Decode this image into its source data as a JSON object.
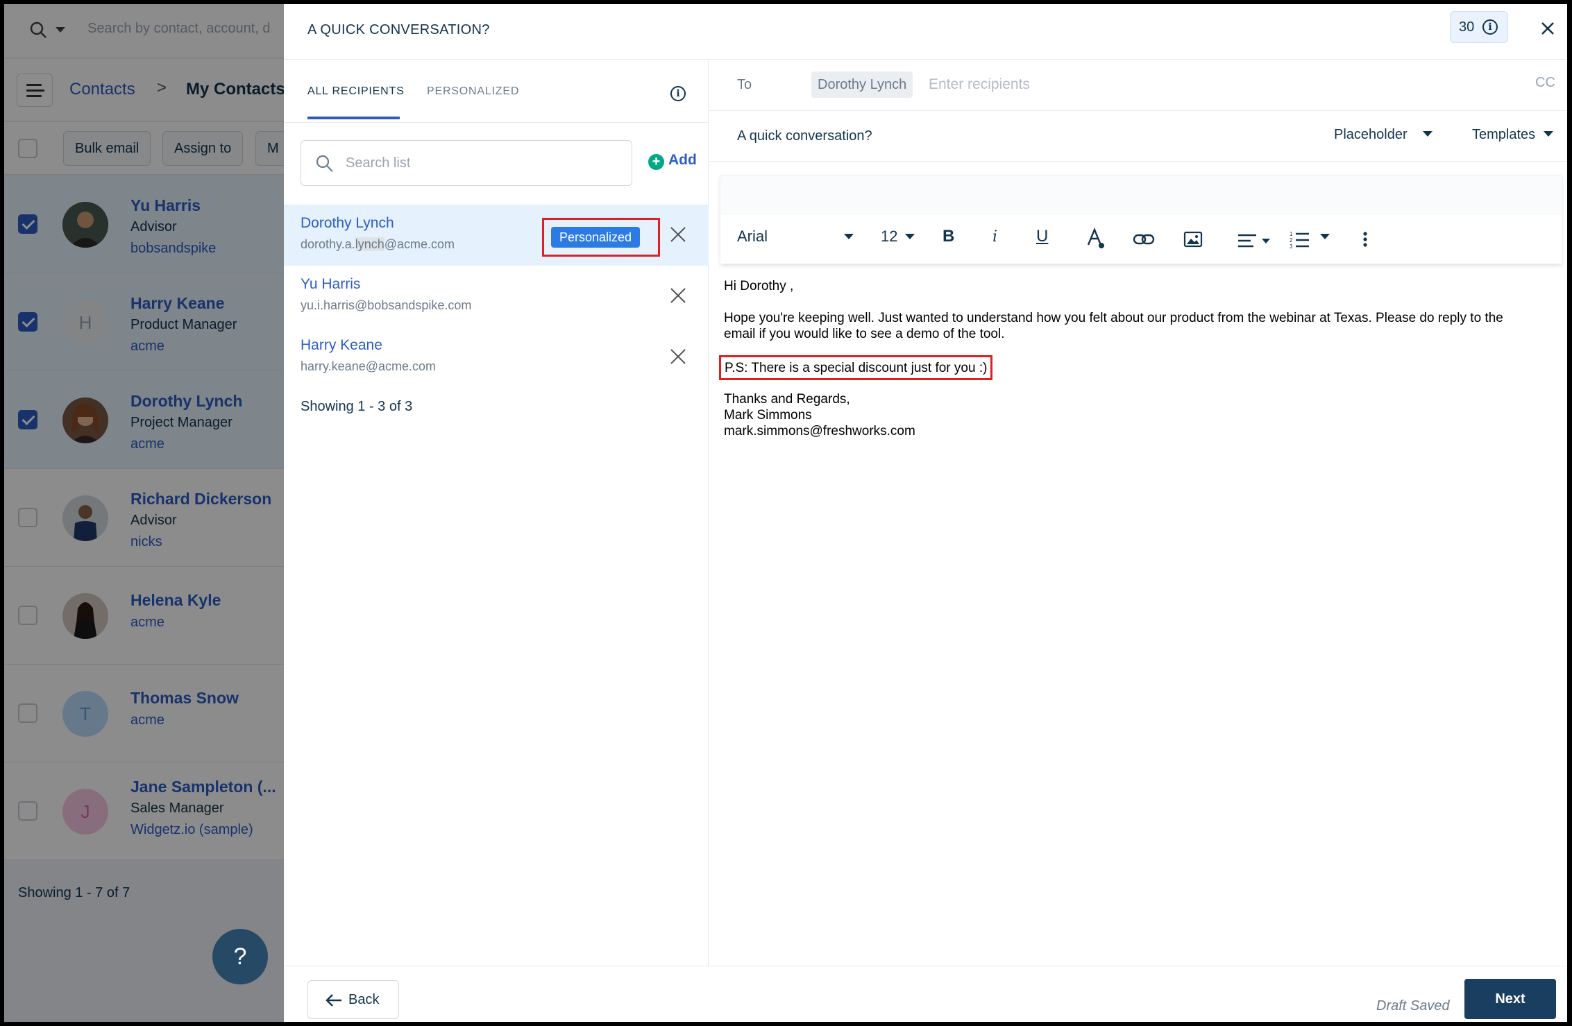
{
  "background": {
    "search_placeholder": "Search by contact, account, d",
    "breadcrumb": {
      "root": "Contacts",
      "separator": ">",
      "current": "My Contacts"
    },
    "actions": [
      "Bulk email",
      "Assign to",
      "M"
    ],
    "contacts": [
      {
        "name": "Yu Harris",
        "title": "Advisor",
        "account": "bobsandspike",
        "checked": true,
        "initial": ""
      },
      {
        "name": "Harry Keane",
        "title": "Product Manager",
        "account": "acme",
        "checked": true,
        "initial": "H"
      },
      {
        "name": "Dorothy Lynch",
        "title": "Project Manager",
        "account": "acme",
        "checked": true,
        "initial": ""
      },
      {
        "name": "Richard Dickerson",
        "title": "Advisor",
        "account": "nicks",
        "checked": false,
        "initial": ""
      },
      {
        "name": "Helena Kyle",
        "title": "",
        "account": "acme",
        "checked": false,
        "initial": ""
      },
      {
        "name": "Thomas Snow",
        "title": "",
        "account": "acme",
        "checked": false,
        "initial": "T"
      },
      {
        "name": "Jane Sampleton (...",
        "title": "Sales Manager",
        "account": "Widgetz.io (sample)",
        "checked": false,
        "initial": "J"
      }
    ],
    "count_text": "Showing 1 - 7 of 7",
    "help_label": "?"
  },
  "modal": {
    "title": "A QUICK CONVERSATION?",
    "credits": "30",
    "tabs": {
      "all": "ALL RECIPIENTS",
      "personalized": "PERSONALIZED"
    },
    "search_placeholder": "Search list",
    "add_label": "Add",
    "recipients": [
      {
        "name": "Dorothy Lynch",
        "email_pre": "dorothy.a.",
        "email_hl": "lynch",
        "email_post": "@acme.com",
        "badge": "Personalized"
      },
      {
        "name": "Yu Harris",
        "email": "yu.i.harris@bobsandspike.com"
      },
      {
        "name": "Harry Keane",
        "email": "harry.keane@acme.com"
      }
    ],
    "recipients_count": "Showing 1 - 3 of 3",
    "compose": {
      "to_label": "To",
      "to_chip": "Dorothy Lynch",
      "to_placeholder": "Enter recipients",
      "cc_label": "CC",
      "subject": "A quick conversation?",
      "placeholder_dd": "Placeholder",
      "templates_dd": "Templates",
      "toolbar": {
        "font": "Arial",
        "size": "12"
      },
      "body": {
        "greeting": "Hi Dorothy ,",
        "para1_line1": "Hope you're keeping well. Just wanted to understand how you felt about our product from the webinar at Texas. Please do reply to the",
        "para1_line2": "email if you would like to see a demo of the tool.",
        "ps": "P.S: There is a special discount just for you :)",
        "signoff": "Thanks and Regards,",
        "sender_name": "Mark Simmons",
        "sender_email": "mark.simmons@freshworks.com"
      }
    },
    "footer": {
      "back": "Back",
      "draft_status": "Draft Saved",
      "next": "Next"
    }
  },
  "colors": {
    "primary": "#2c5cc5",
    "highlight_box": "#e02020",
    "next_button": "#1a3e5f",
    "badge": "#2c7be5"
  }
}
